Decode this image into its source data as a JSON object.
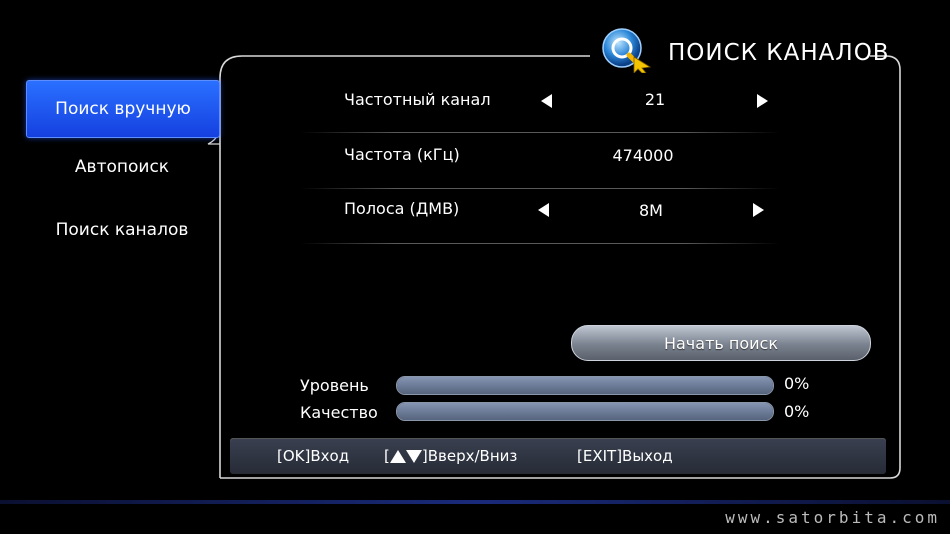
{
  "header": {
    "title": "ПОИСК КАНАЛОВ",
    "icon": "search-globe-icon"
  },
  "sidebar": {
    "items": [
      {
        "label": "Поиск вручную",
        "active": true
      },
      {
        "label": "Автопоиск",
        "active": false
      },
      {
        "label": "Поиск каналов",
        "active": false
      }
    ]
  },
  "form": {
    "rows": [
      {
        "label": "Частотный канал",
        "value": "21"
      },
      {
        "label": "Частота (кГц)",
        "value": "474000"
      },
      {
        "label": "Полоса (ДМВ)",
        "value": "8M"
      }
    ]
  },
  "actions": {
    "start_label": "Начать поиск"
  },
  "meters": {
    "level": {
      "label": "Уровень",
      "value_text": "0%",
      "value": 0
    },
    "quality": {
      "label": "Качество",
      "value_text": "0%",
      "value": 0
    }
  },
  "footer": {
    "ok_hint": "[OK]Вход",
    "nav_hint_open": "[",
    "nav_hint_close": "]Вверх/Вниз",
    "exit_hint": "[EXIT]Выход"
  },
  "watermark": "www.satorbita.com",
  "colors": {
    "accent": "#1f55f0",
    "panel": "#2f3542"
  }
}
